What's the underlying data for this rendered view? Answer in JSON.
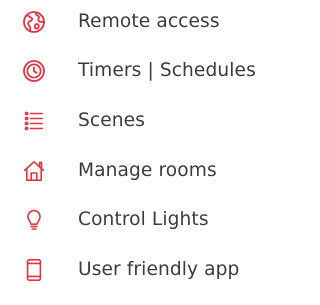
{
  "accent_color": "#e5333f",
  "text_color": "#3b3b3b",
  "features": [
    {
      "label": "Remote access",
      "icon": "globe-icon"
    },
    {
      "label": "Timers | Schedules",
      "icon": "clock-icon"
    },
    {
      "label": "Scenes",
      "icon": "list-icon"
    },
    {
      "label": "Manage rooms",
      "icon": "house-icon"
    },
    {
      "label": "Control Lights",
      "icon": "lightbulb-icon"
    },
    {
      "label": "User friendly app",
      "icon": "smartphone-icon"
    }
  ]
}
